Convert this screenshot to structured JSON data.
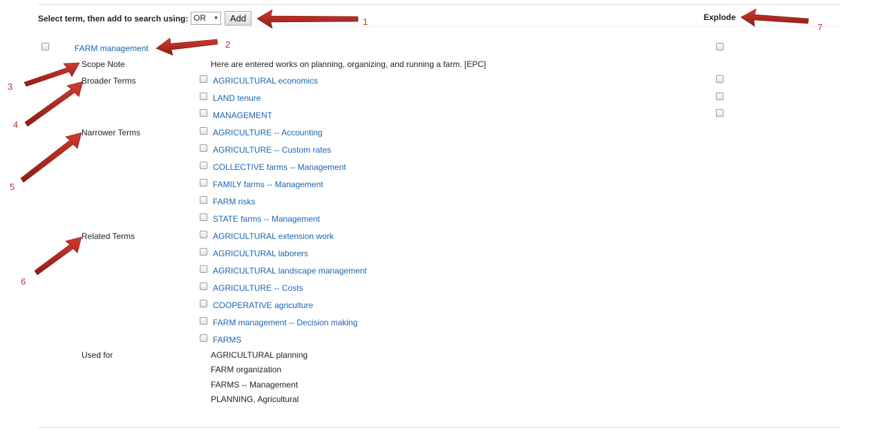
{
  "toolbar": {
    "label": "Select term, then add to search using:",
    "operator_selected": "OR",
    "add_label": "Add",
    "explode_label": "Explode"
  },
  "main_term": {
    "label": "FARM management"
  },
  "scope_note": {
    "label": "Scope Note",
    "text": "Here are entered works on planning, organizing, and running a farm. [EPC]"
  },
  "broader": {
    "label": "Broader Terms",
    "items": [
      "AGRICULTURAL economics",
      "LAND tenure",
      "MANAGEMENT"
    ]
  },
  "narrower": {
    "label": "Narrower Terms",
    "items": [
      "AGRICULTURE -- Accounting",
      "AGRICULTURE -- Custom rates",
      "COLLECTIVE farms -- Management",
      "FAMILY farms -- Management",
      "FARM risks",
      "STATE farms -- Management"
    ]
  },
  "related": {
    "label": "Related Terms",
    "items": [
      "AGRICULTURAL extension work",
      "AGRICULTURAL laborers",
      "AGRICULTURAL landscape management",
      "AGRICULTURE -- Costs",
      "COOPERATIVE agriculture",
      "FARM management -- Decision making",
      "FARMS"
    ]
  },
  "used_for": {
    "label": "Used for",
    "items": [
      "AGRICULTURAL planning",
      "FARM organization",
      "FARMS -- Management",
      "PLANNING, Agricultural"
    ]
  },
  "annotations": [
    "1",
    "2",
    "3",
    "4",
    "5",
    "6",
    "7"
  ],
  "colors": {
    "link": "#1a64b0",
    "arrow": "#b22a22",
    "annotation_text": "#c0302a"
  }
}
